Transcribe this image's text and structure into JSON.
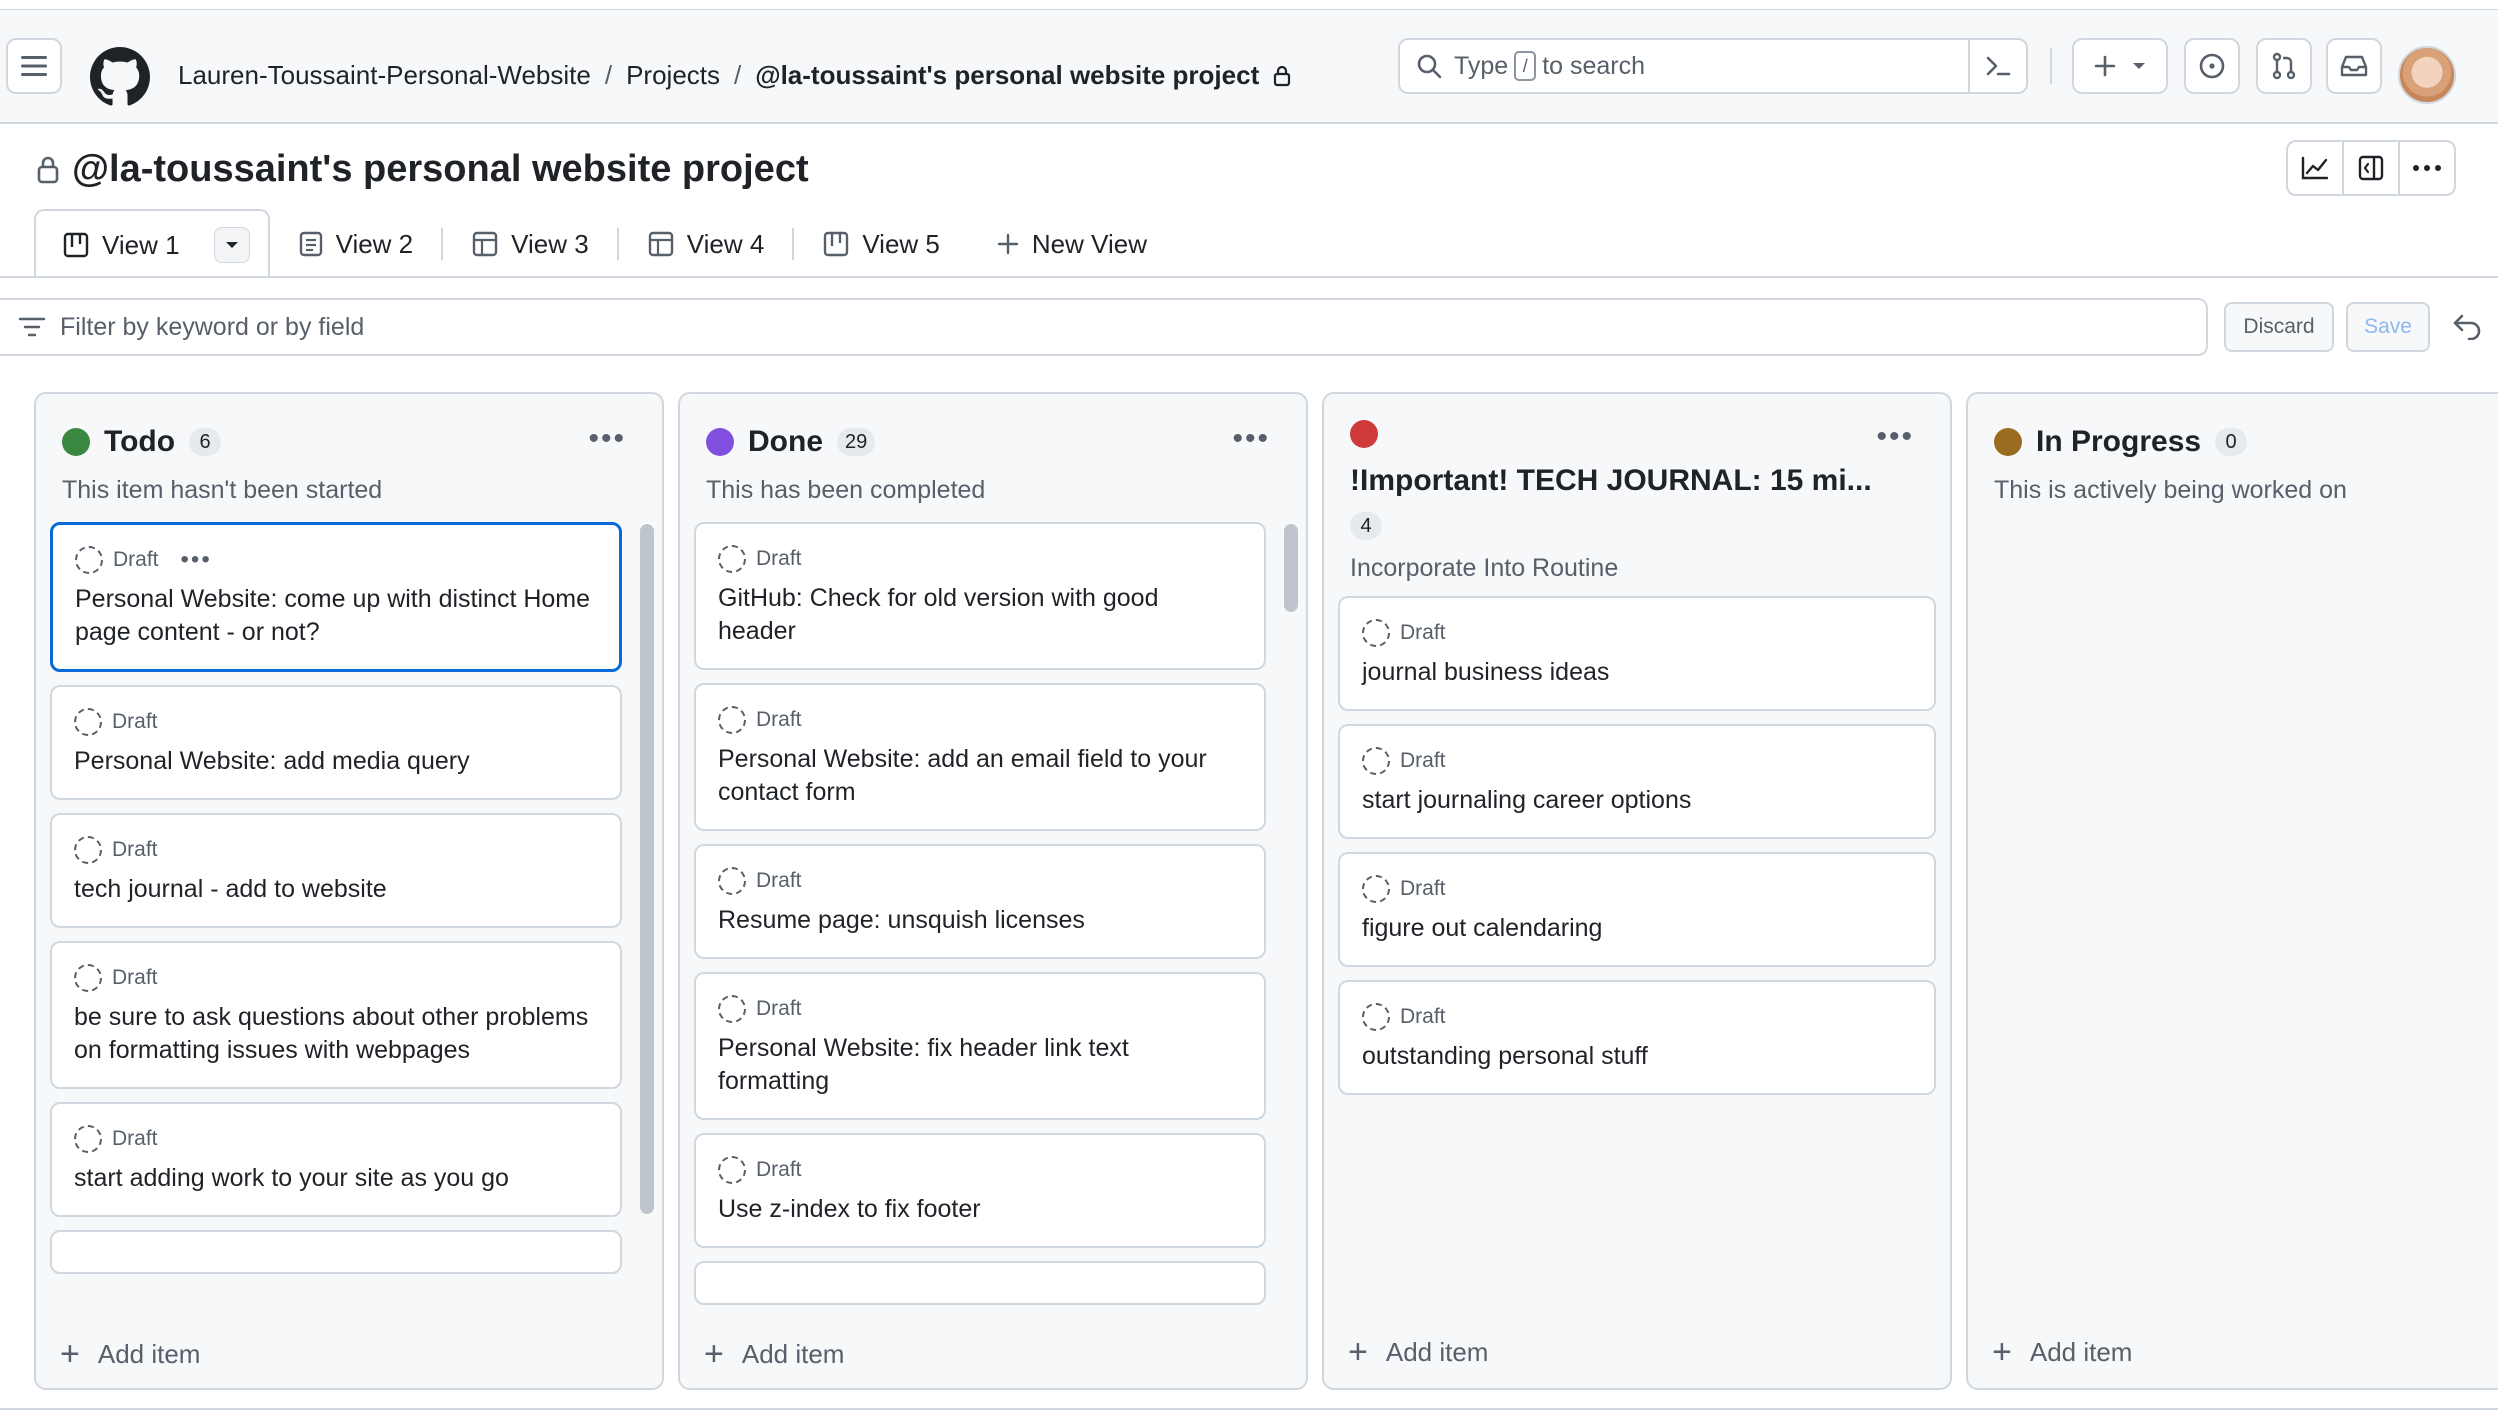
{
  "header": {
    "breadcrumb": [
      "Lauren-Toussaint-Personal-Website",
      "Projects",
      "@la-toussaint's personal website project"
    ],
    "breadcrumb_sep": "/",
    "search_prefix": "Type",
    "search_key": "/",
    "search_suffix": "to search"
  },
  "project": {
    "title": "@la-toussaint's personal website project",
    "tabs": [
      {
        "label": "View 1",
        "icon": "board-icon"
      },
      {
        "label": "View 2",
        "icon": "document-icon"
      },
      {
        "label": "View 3",
        "icon": "table-icon"
      },
      {
        "label": "View 4",
        "icon": "table-icon"
      },
      {
        "label": "View 5",
        "icon": "board-icon"
      }
    ],
    "new_view": "New View"
  },
  "filter": {
    "placeholder": "Filter by keyword or by field",
    "discard": "Discard",
    "save": "Save"
  },
  "colors": {
    "todo": "#3a873f",
    "done": "#8250df",
    "important": "#cf3a3a",
    "in_progress": "#9a6c1f",
    "accent": "#0969da"
  },
  "columns": [
    {
      "name": "Todo",
      "count": "6",
      "description": "This item hasn't been started",
      "add_label": "Add item",
      "cards": [
        {
          "status": "Draft",
          "title": "Personal Website: come up with distinct Home page content - or not?"
        },
        {
          "status": "Draft",
          "title": "Personal Website: add media query"
        },
        {
          "status": "Draft",
          "title": "tech journal - add to website"
        },
        {
          "status": "Draft",
          "title": "be sure to ask questions about other problems on formatting issues with webpages"
        },
        {
          "status": "Draft",
          "title": "start adding work to your site as you go"
        }
      ]
    },
    {
      "name": "Done",
      "count": "29",
      "description": "This has been completed",
      "add_label": "Add item",
      "cards": [
        {
          "status": "Draft",
          "title": "GitHub: Check for old version with good header"
        },
        {
          "status": "Draft",
          "title": "Personal Website: add an email field to your contact form"
        },
        {
          "status": "Draft",
          "title": "Resume page: unsquish licenses"
        },
        {
          "status": "Draft",
          "title": "Personal Website: fix header link text formatting"
        },
        {
          "status": "Draft",
          "title": "Use z-index to fix footer"
        }
      ]
    },
    {
      "name": "!Important! TECH JOURNAL: 15 mi...",
      "count": "4",
      "description": "Incorporate Into Routine",
      "add_label": "Add item",
      "cards": [
        {
          "status": "Draft",
          "title": "journal business ideas"
        },
        {
          "status": "Draft",
          "title": "start journaling career options"
        },
        {
          "status": "Draft",
          "title": "figure out calendaring"
        },
        {
          "status": "Draft",
          "title": "outstanding personal stuff"
        }
      ]
    },
    {
      "name": "In Progress",
      "count": "0",
      "description": "This is actively being worked on",
      "add_label": "Add item",
      "cards": []
    }
  ]
}
